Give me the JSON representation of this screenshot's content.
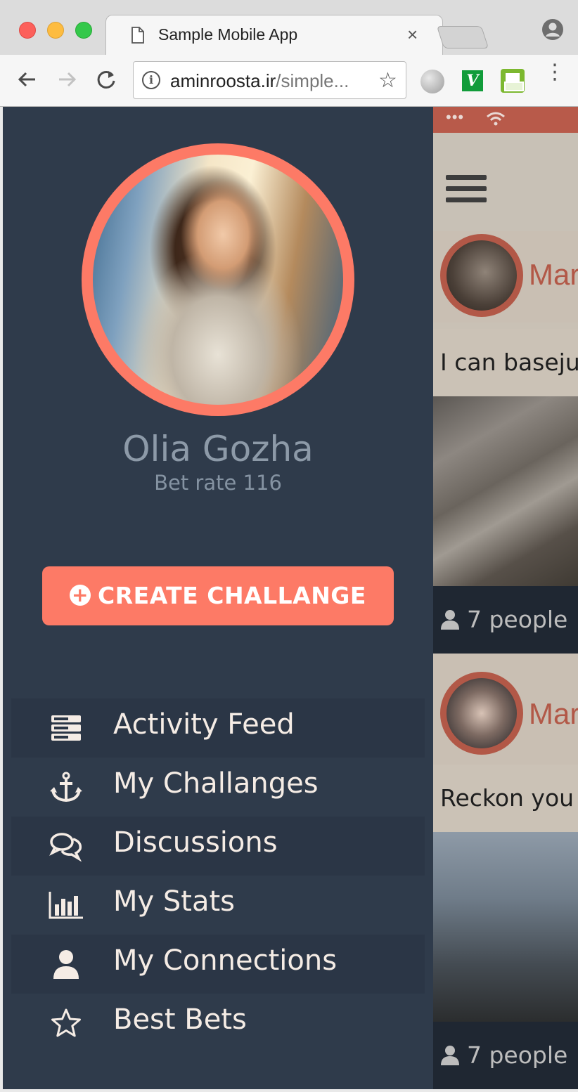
{
  "browser": {
    "tab_title": "Sample Mobile App",
    "tab_close": "×",
    "url_host": "aminroosta.ir",
    "url_path": "/simple...",
    "ext_v_label": "V"
  },
  "background_app": {
    "status_dots": "•••",
    "cards": [
      {
        "name": "Mar",
        "text": "I can basejur",
        "footer": "7 people",
        "photo": "rock"
      },
      {
        "name": "Mar",
        "text": "Reckon you",
        "footer": "7 people",
        "photo": "sky"
      }
    ]
  },
  "drawer": {
    "profile": {
      "name": "Olia Gozha",
      "bet_rate": "Bet rate 116"
    },
    "create_button": "CREATE CHALLANGE",
    "menu": [
      {
        "icon": "activity-feed-icon",
        "label": "Activity Feed"
      },
      {
        "icon": "anchor-icon",
        "label": "My Challanges"
      },
      {
        "icon": "comments-icon",
        "label": "Discussions"
      },
      {
        "icon": "bar-chart-icon",
        "label": "My Stats"
      },
      {
        "icon": "user-icon",
        "label": "My Connections"
      },
      {
        "icon": "star-icon",
        "label": "Best Bets"
      }
    ]
  },
  "colors": {
    "accent": "#fd7a66",
    "drawer_bg": "#2f3b4b",
    "menu_text": "#f5ece5",
    "muted_text": "#8d9aa8"
  }
}
